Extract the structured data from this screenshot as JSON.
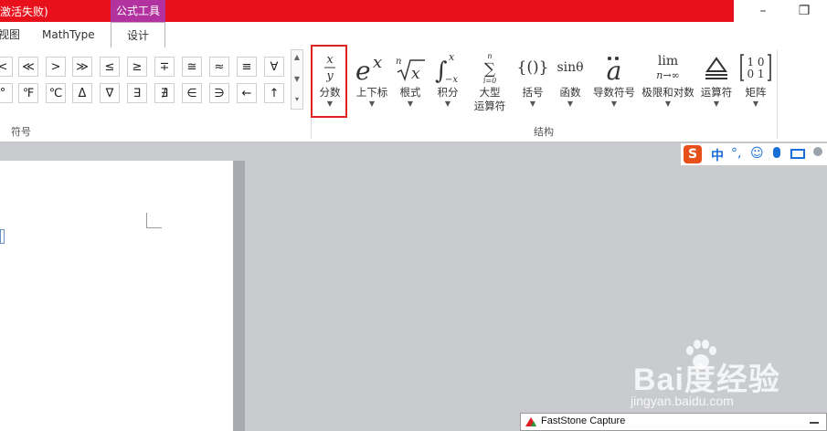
{
  "title_bar": {
    "title": "激活失败)",
    "context_tab": "公式工具",
    "color": "#e8101b",
    "context_color": "#b2339f"
  },
  "tabs": [
    "视图",
    "MathType",
    "设计"
  ],
  "symbols": {
    "row1": [
      "<",
      "≪",
      ">",
      "≫",
      "≤",
      "≥",
      "∓",
      "≅",
      "≈",
      "≡",
      "∀"
    ],
    "row2": [
      "°",
      "℉",
      "℃",
      "Δ",
      "∇",
      "∃",
      "∄",
      "∈",
      "∋",
      "←",
      "↑"
    ],
    "group_label": "符号"
  },
  "structures": {
    "items": [
      {
        "label": "分数",
        "icon": "fraction-icon"
      },
      {
        "label": "上下标",
        "icon": "script-icon"
      },
      {
        "label": "根式",
        "icon": "radical-icon"
      },
      {
        "label": "积分",
        "icon": "integral-icon"
      },
      {
        "label": "大型",
        "label2": "运算符",
        "icon": "large-operator-icon"
      },
      {
        "label": "括号",
        "icon": "bracket-icon"
      },
      {
        "label": "函数",
        "icon": "function-icon",
        "glyph": "sinθ"
      },
      {
        "label": "导数符号",
        "icon": "accent-icon"
      },
      {
        "label": "极限和对数",
        "icon": "limit-icon",
        "glyph_top": "lim",
        "glyph_bottom": "n→∞"
      },
      {
        "label": "运算符",
        "icon": "operator-icon"
      },
      {
        "label": "矩阵",
        "icon": "matrix-icon"
      }
    ],
    "group_label": "结构"
  },
  "ime": {
    "lang": "中",
    "punct": "°,"
  },
  "faststone": {
    "title": "FastStone Capture"
  },
  "watermark": {
    "logo": "Bai度经验",
    "url": "jingyan.baidu.com"
  }
}
